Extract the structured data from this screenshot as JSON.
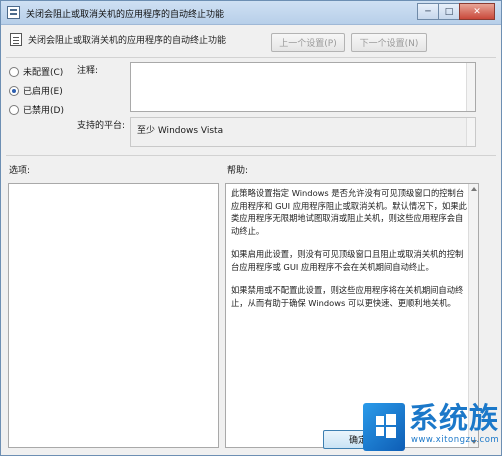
{
  "window": {
    "title": "关闭会阻止或取消关机的应用程序的自动终止功能",
    "controls": {
      "minimize": "─",
      "maximize": "□",
      "close": "✕"
    }
  },
  "header": {
    "policy_title": "关闭会阻止或取消关机的应用程序的自动终止功能",
    "prev_setting": "上一个设置(P)",
    "next_setting": "下一个设置(N)"
  },
  "state_options": [
    {
      "label": "未配置(C)",
      "selected": false
    },
    {
      "label": "已启用(E)",
      "selected": true
    },
    {
      "label": "已禁用(D)",
      "selected": false
    }
  ],
  "comment": {
    "label": "注释:",
    "value": ""
  },
  "platform": {
    "label": "支持的平台:",
    "value": "至少 Windows Vista"
  },
  "options": {
    "label": "选项:"
  },
  "help": {
    "label": "帮助:",
    "paragraphs": [
      "此策略设置指定 Windows 是否允许没有可见顶级窗口的控制台应用程序和 GUI 应用程序阻止或取消关机。默认情况下，如果此类应用程序无限期地试图取消或阻止关机，则这些应用程序会自动终止。",
      "如果启用此设置，则没有可见顶级窗口且阻止或取消关机的控制台应用程序或 GUI 应用程序不会在关机期间自动终止。",
      "如果禁用或不配置此设置，则这些应用程序将在关机期间自动终止，从而有助于确保 Windows 可以更快速、更顺利地关机。"
    ]
  },
  "buttons": {
    "ok": "确定"
  },
  "watermark": {
    "brand": "系统族",
    "site": "www.xitongzu.com"
  },
  "colors": {
    "accent": "#1b78c9",
    "titlebar": "#c3d7ee"
  }
}
